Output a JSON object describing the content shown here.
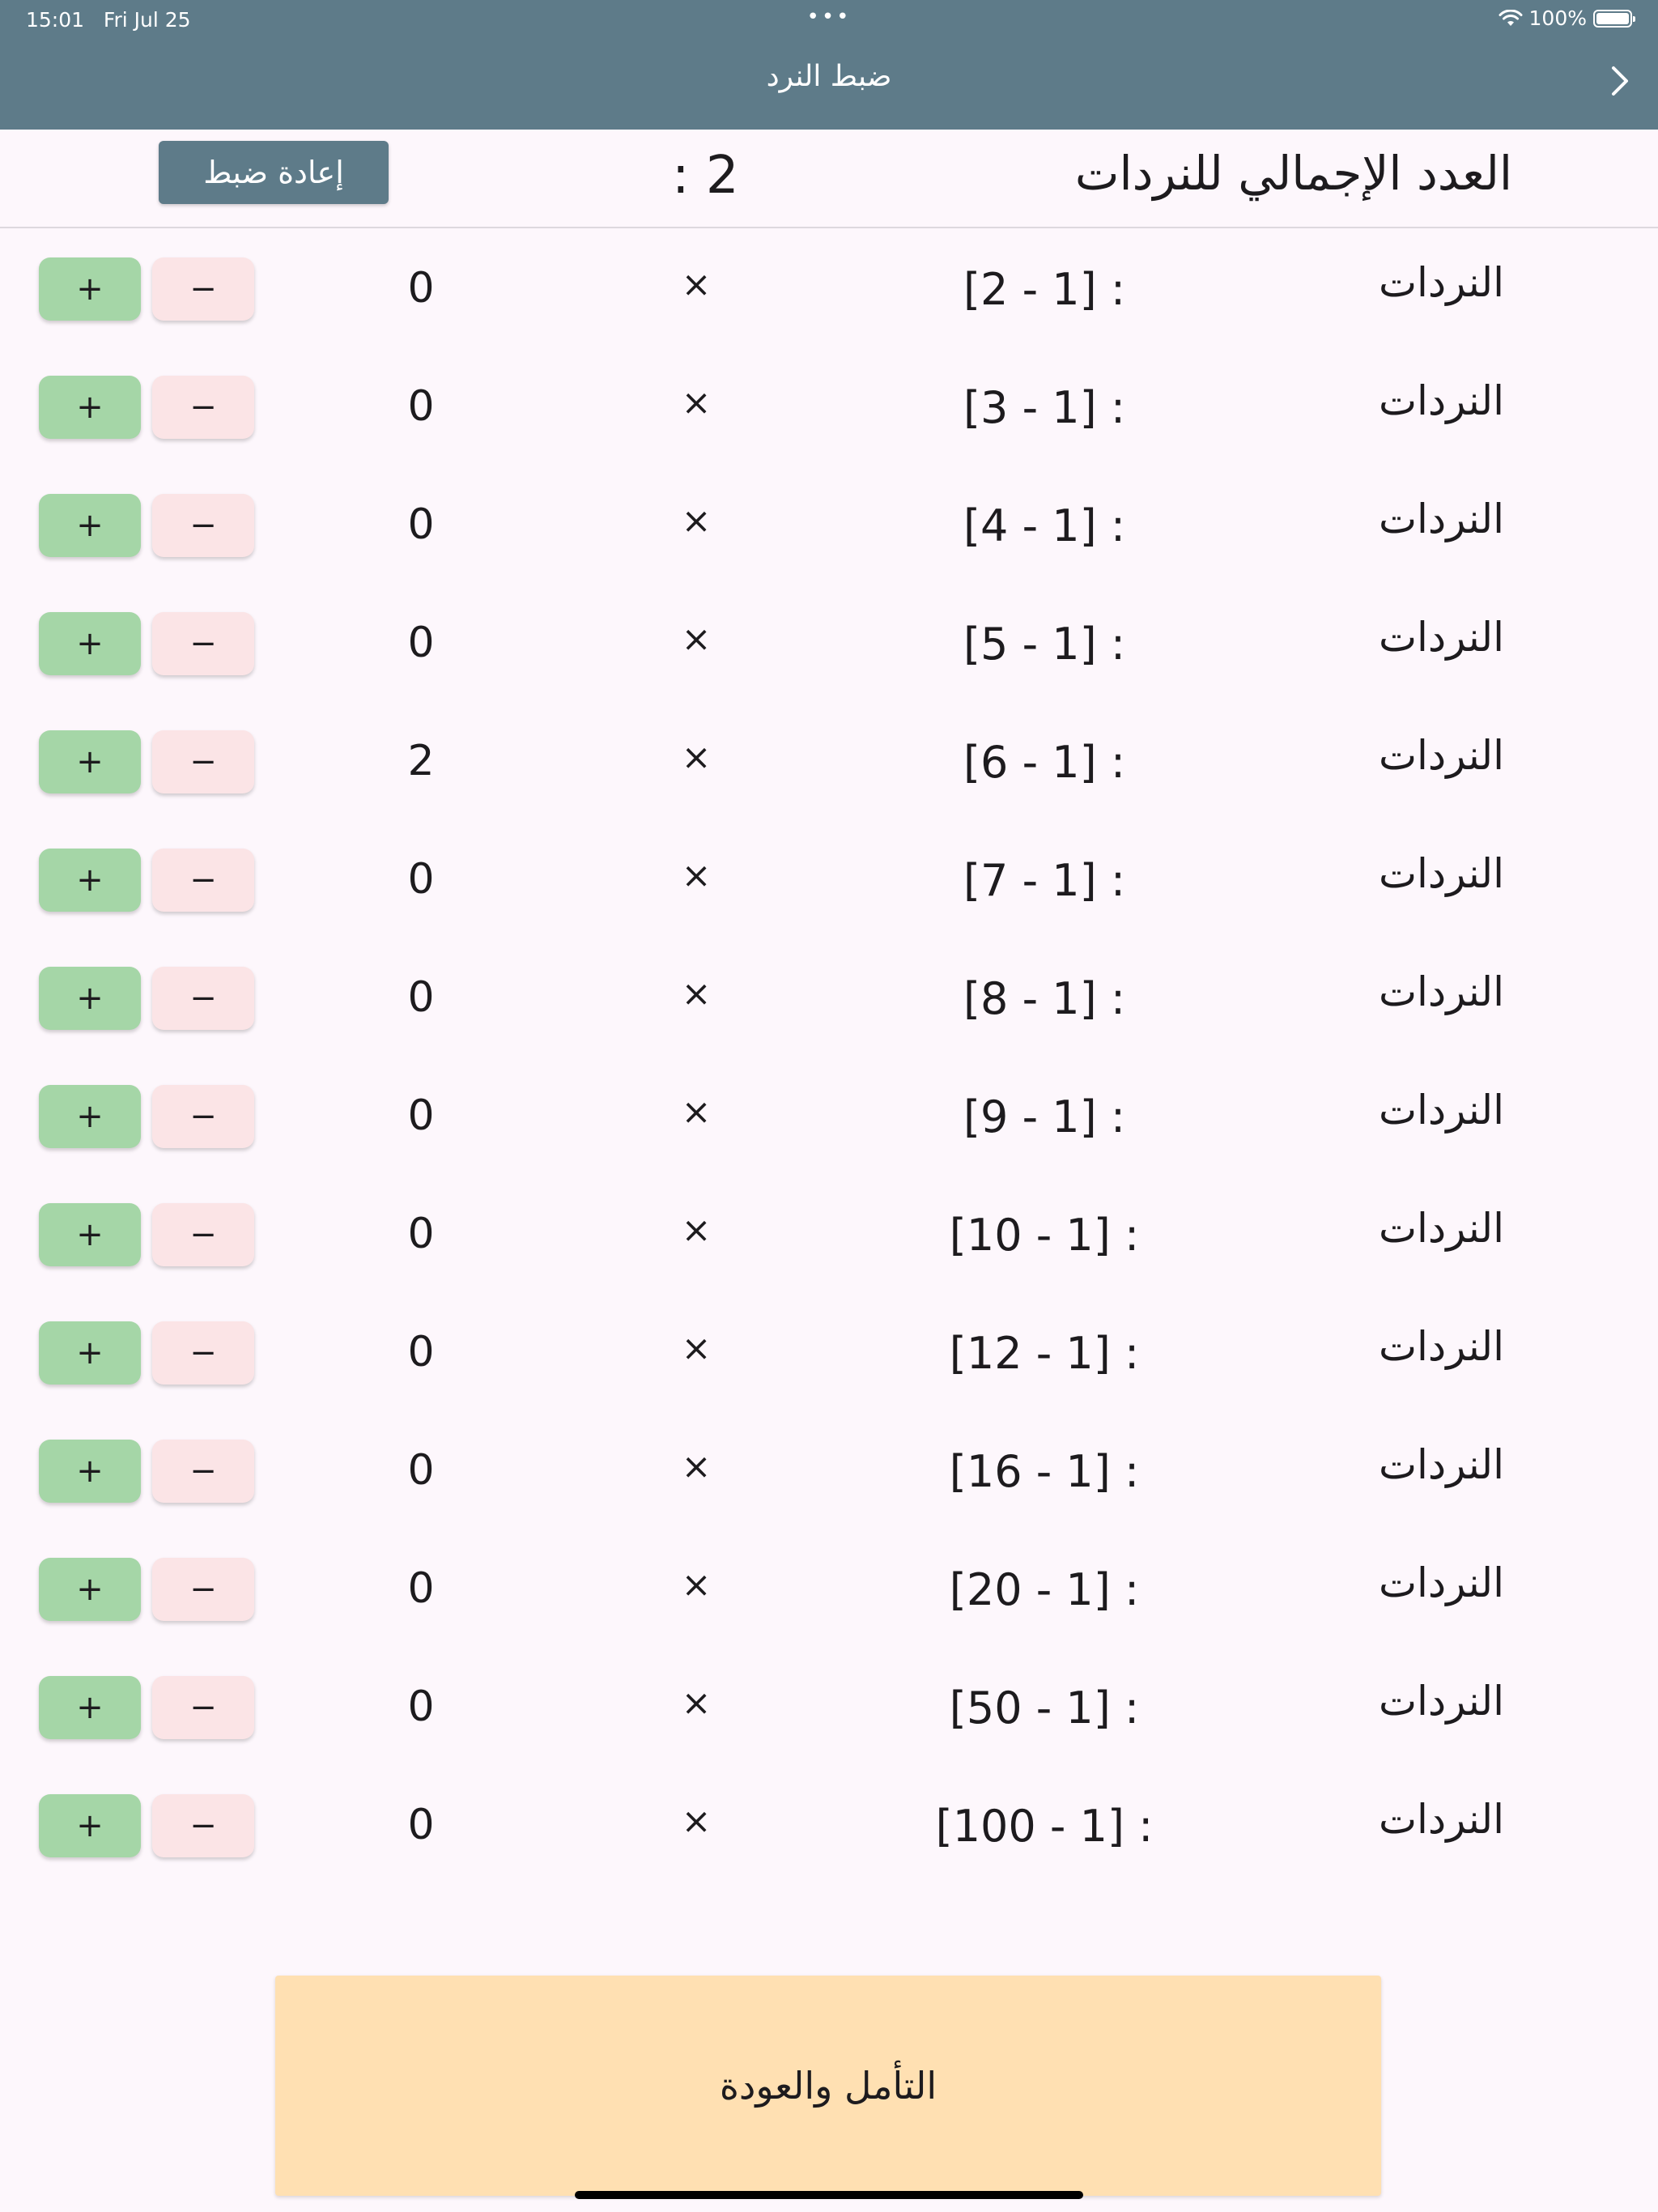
{
  "status_bar": {
    "time": "15:01",
    "date": "Fri Jul 25",
    "dots": "•••",
    "battery": "100%"
  },
  "nav": {
    "title": "ضبط النرد"
  },
  "summary": {
    "label": "العدد الإجمالي للنردات",
    "value": "2 :",
    "reset_label": "إعادة ضبط"
  },
  "rows": [
    {
      "label": "النردات",
      "range": "[2 - 1] :",
      "times": "×",
      "count": "0",
      "minus": "−",
      "plus": "+"
    },
    {
      "label": "النردات",
      "range": "[3 - 1] :",
      "times": "×",
      "count": "0",
      "minus": "−",
      "plus": "+"
    },
    {
      "label": "النردات",
      "range": "[4 - 1] :",
      "times": "×",
      "count": "0",
      "minus": "−",
      "plus": "+"
    },
    {
      "label": "النردات",
      "range": "[5 - 1] :",
      "times": "×",
      "count": "0",
      "minus": "−",
      "plus": "+"
    },
    {
      "label": "النردات",
      "range": "[6 - 1] :",
      "times": "×",
      "count": "2",
      "minus": "−",
      "plus": "+"
    },
    {
      "label": "النردات",
      "range": "[7 - 1] :",
      "times": "×",
      "count": "0",
      "minus": "−",
      "plus": "+"
    },
    {
      "label": "النردات",
      "range": "[8 - 1] :",
      "times": "×",
      "count": "0",
      "minus": "−",
      "plus": "+"
    },
    {
      "label": "النردات",
      "range": "[9 - 1] :",
      "times": "×",
      "count": "0",
      "minus": "−",
      "plus": "+"
    },
    {
      "label": "النردات",
      "range": "[10 - 1] :",
      "times": "×",
      "count": "0",
      "minus": "−",
      "plus": "+"
    },
    {
      "label": "النردات",
      "range": "[12 - 1] :",
      "times": "×",
      "count": "0",
      "minus": "−",
      "plus": "+"
    },
    {
      "label": "النردات",
      "range": "[16 - 1] :",
      "times": "×",
      "count": "0",
      "minus": "−",
      "plus": "+"
    },
    {
      "label": "النردات",
      "range": "[20 - 1] :",
      "times": "×",
      "count": "0",
      "minus": "−",
      "plus": "+"
    },
    {
      "label": "النردات",
      "range": "[50 - 1] :",
      "times": "×",
      "count": "0",
      "minus": "−",
      "plus": "+"
    },
    {
      "label": "النردات",
      "range": "[100 - 1] :",
      "times": "×",
      "count": "0",
      "minus": "−",
      "plus": "+"
    }
  ],
  "confirm": {
    "label": "التأمل والعودة"
  },
  "colors": {
    "header": "#5e7b89",
    "plus": "#a5d6a7",
    "minus": "#fbe4e6",
    "confirm": "#ffe0b2",
    "background": "#fdf7fc"
  }
}
